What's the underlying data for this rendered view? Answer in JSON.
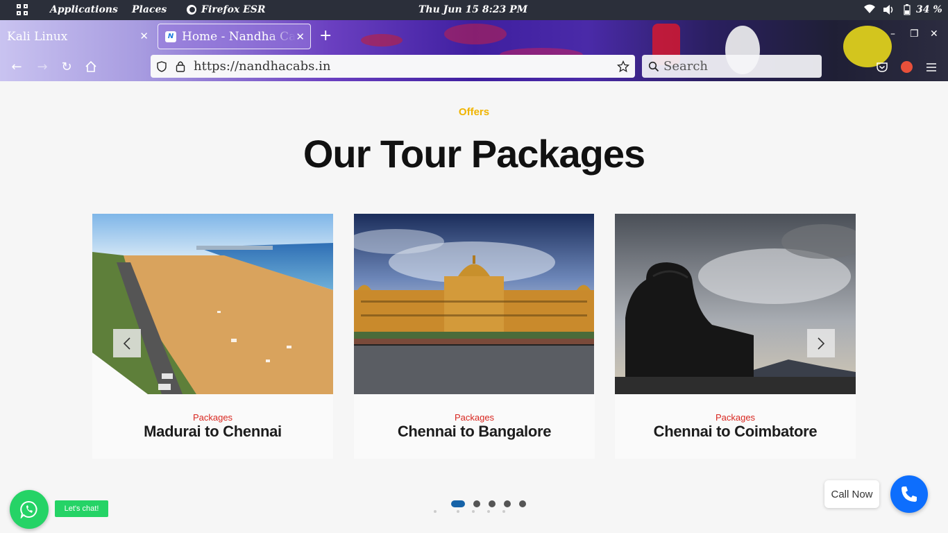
{
  "os_panel": {
    "applications": "Applications",
    "places": "Places",
    "browser": "Firefox ESR",
    "datetime": "Thu Jun 15   8:23 PM",
    "battery": "34 %",
    "icons": [
      "apps-grid-icon",
      "firefox-icon",
      "wifi-icon",
      "volume-icon",
      "battery-icon"
    ]
  },
  "browser": {
    "tabs": [
      {
        "label": "Kali Linux"
      },
      {
        "label": "Home - Nandha Cabs"
      }
    ],
    "url": "https://nandhacabs.in",
    "search_placeholder": "Search"
  },
  "page": {
    "eyebrow": "Offers",
    "heading": "Our Tour Packages",
    "cards": [
      {
        "category": "Packages",
        "title": "Madurai to Chennai"
      },
      {
        "category": "Packages",
        "title": "Chennai to Bangalore"
      },
      {
        "category": "Packages",
        "title": "Chennai to Coimbatore"
      }
    ],
    "carousel_active_dot": 1,
    "carousel_dot_count": 5
  },
  "widgets": {
    "whatsapp_label": "Let's chat!",
    "call_label": "Call Now"
  },
  "colors": {
    "eyebrow": "#f0b400",
    "category": "#d8261f",
    "active_dot": "#1663a8",
    "whatsapp": "#25d366",
    "call": "#0d6efd"
  }
}
